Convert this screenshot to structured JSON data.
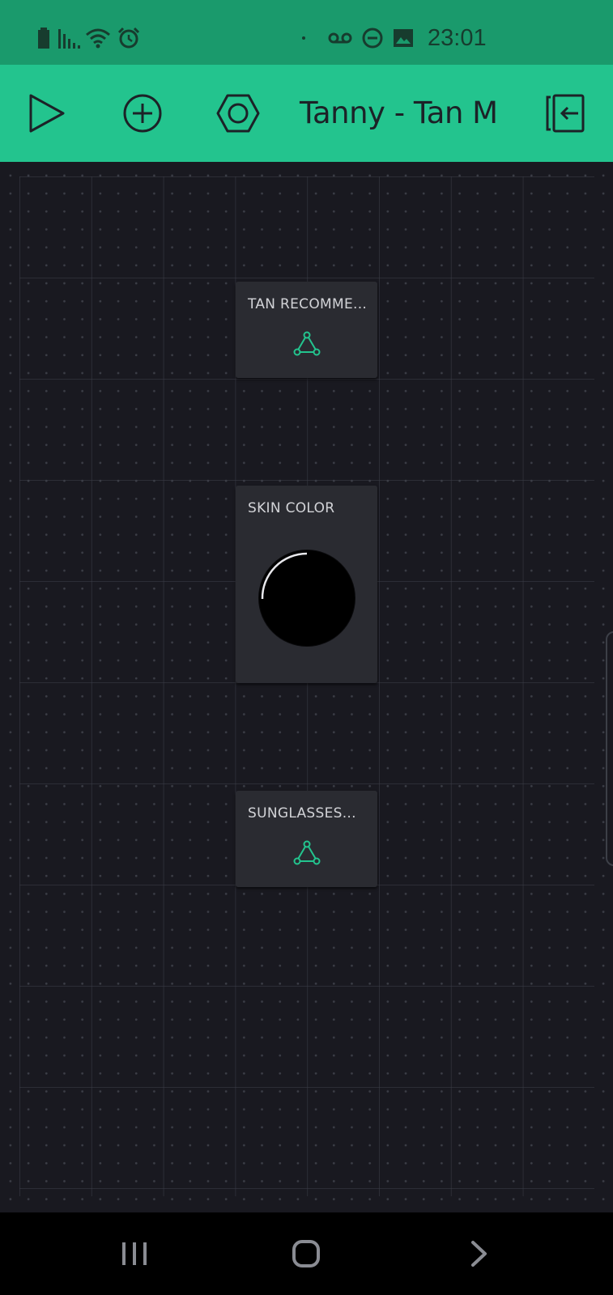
{
  "status_bar": {
    "time": "23:01",
    "icons": [
      "battery-icon",
      "signal-icon",
      "wifi-icon",
      "alarm-icon",
      "dot-icon",
      "voicemail-icon",
      "do-not-disturb-icon",
      "image-icon"
    ]
  },
  "toolbar": {
    "title": "Tanny - Tan M",
    "buttons": [
      "play-icon",
      "add-widget-icon",
      "settings-icon",
      "exit-icon"
    ]
  },
  "widgets": [
    {
      "title": "TAN RECOMME...",
      "icon": "webhook-icon"
    },
    {
      "title": "SKIN COLOR",
      "icon": "knob"
    },
    {
      "title": "SUNGLASSES...",
      "icon": "webhook-icon"
    }
  ],
  "nav_bar": {
    "buttons": [
      "recent-apps-icon",
      "home-icon",
      "back-icon"
    ]
  },
  "colors": {
    "status_bar": "#1a9a6c",
    "toolbar": "#23c48e",
    "canvas": "#191920",
    "widget": "#2a2b31",
    "accent": "#23c48e"
  }
}
